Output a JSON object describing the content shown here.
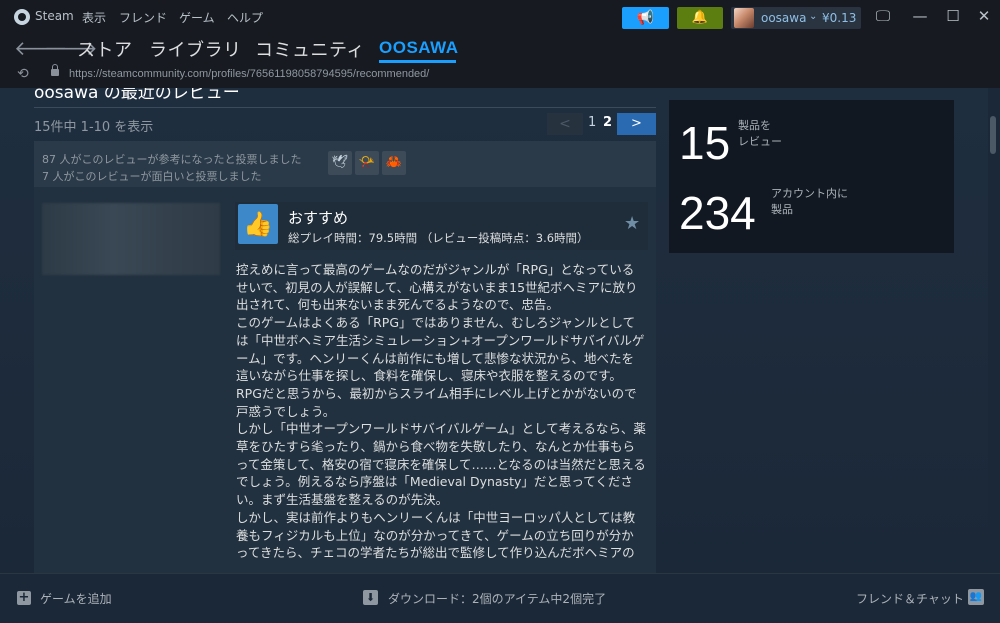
{
  "titlebar": {
    "app_name": "Steam",
    "menus": [
      "表示",
      "フレンド",
      "ゲーム",
      "ヘルプ"
    ],
    "account_name": "oosawa",
    "wallet": "¥0.13",
    "account_arrow": "⌄"
  },
  "nav": {
    "store": "ストア",
    "library": "ライブラリ",
    "community": "コミュニティ",
    "user": "OOSAWA",
    "accent": "#1a9fff"
  },
  "url": {
    "text": "https://steamcommunity.com/profiles/76561198058794595/recommended/"
  },
  "reviews": {
    "section_title": "oosawa の最近のレビュー",
    "count_text": "15件中 1-10 を表示",
    "pagination": {
      "prev": "<",
      "page1": "1",
      "page2": "2",
      "next": ">"
    },
    "votes_helpful": "87 人がこのレビューが参考になったと投票しました",
    "votes_funny": "7 人がこのレビューが面白いと投票しました",
    "recommendation": "おすすめ",
    "hours": "総プレイ時間：79.5時間 （レビュー投稿時点：3.6時間）",
    "body": [
      "控えめに言って最高のゲームなのだがジャンルが「RPG」となっているせいで、初見の人が誤解して、心構えがないまま15世紀ボヘミアに放り出されて、何も出来ないまま死んでるようなので、忠告。",
      "このゲームはよくある「RPG」ではありません、むしろジャンルとしては「中世ボヘミア生活シミュレーション+オープンワールドサバイバルゲーム」です。ヘンリーくんは前作にも増して悲惨な状況から、地べたを這いながら仕事を探し、食料を確保し、寝床や衣服を整えるのです。RPGだと思うから、最初からスライム相手にレベル上げとかがないので戸惑うでしょう。",
      "しかし「中世オープンワールドサバイバルゲーム」として考えるなら、薬草をひたすら毟ったり、鍋から食べ物を失敬したり、なんとか仕事もらって金策して、格安の宿で寝床を確保して……となるのは当然だと思えるでしょう。例えるなら序盤は「Medieval Dynasty」だと思ってください。まず生活基盤を整えるのが先決。",
      "しかし、実は前作よりもヘンリーくんは「中世ヨーロッパ人としては教養もフィジカルも上位」なのが分かってきて、ゲームの立ち回りが分かってきたら、チェコの学者たちが総出で監修して作り込んだボヘミアの"
    ]
  },
  "stats": {
    "reviewed_count": "15",
    "reviewed_label_1": "製品を",
    "reviewed_label_2": "レビュー",
    "owned_count": "234",
    "owned_label_1": "アカウント内に",
    "owned_label_2": "製品"
  },
  "bottombar": {
    "add_game": "ゲームを追加",
    "download": "ダウンロード：2個のアイテム中2個完了",
    "friends": "フレンド＆チャット"
  }
}
